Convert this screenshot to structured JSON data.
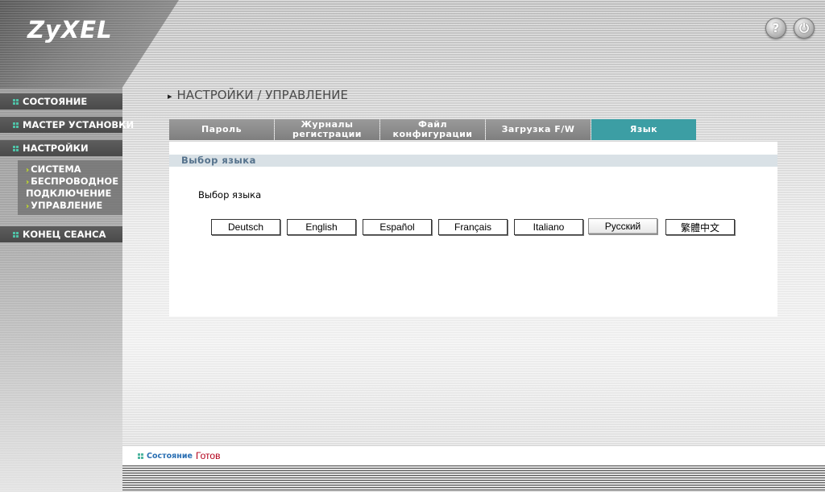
{
  "brand": {
    "logo_text": "ZyXEL"
  },
  "top_icons": [
    {
      "name": "help-icon",
      "glyph": "?"
    },
    {
      "name": "logout-icon",
      "glyph": "⏻"
    }
  ],
  "nav": {
    "status": "СОСТОЯНИЕ",
    "wizard": "МАСТЕР УСТАНОВКИ",
    "settings": "НАСТРОЙКИ",
    "logout": "КОНЕЦ СЕАНСА",
    "sub": {
      "system": "СИСТЕМА",
      "wireless_line1": "БЕСПРОВОДНОЕ",
      "wireless_line2": "ПОДКЛЮЧЕНИЕ",
      "management": "УПРАВЛЕНИЕ"
    }
  },
  "page": {
    "title": "НАСТРОЙКИ / УПРАВЛЕНИЕ"
  },
  "tabs": [
    {
      "line1": "Пароль",
      "line2": ""
    },
    {
      "line1": "Журналы",
      "line2": "регистрации"
    },
    {
      "line1": "Файл",
      "line2": "конфигурации"
    },
    {
      "line1": "Загрузка F/W",
      "line2": ""
    },
    {
      "line1": "Язык",
      "line2": "",
      "active": true
    }
  ],
  "section": {
    "header": "Выбор языка",
    "label": "Выбор языка"
  },
  "languages": [
    "Deutsch",
    "English",
    "Español",
    "Français",
    "Italiano",
    "Русский",
    "繁體中文"
  ],
  "selected_language": "Русский",
  "status": {
    "label": "Состояние",
    "value": "Готов"
  },
  "colors": {
    "active_tab": "#3c9ea4",
    "section_bar": "#d9e1e6",
    "status_value": "#b3001b",
    "bullet": "#4fc3a8"
  }
}
